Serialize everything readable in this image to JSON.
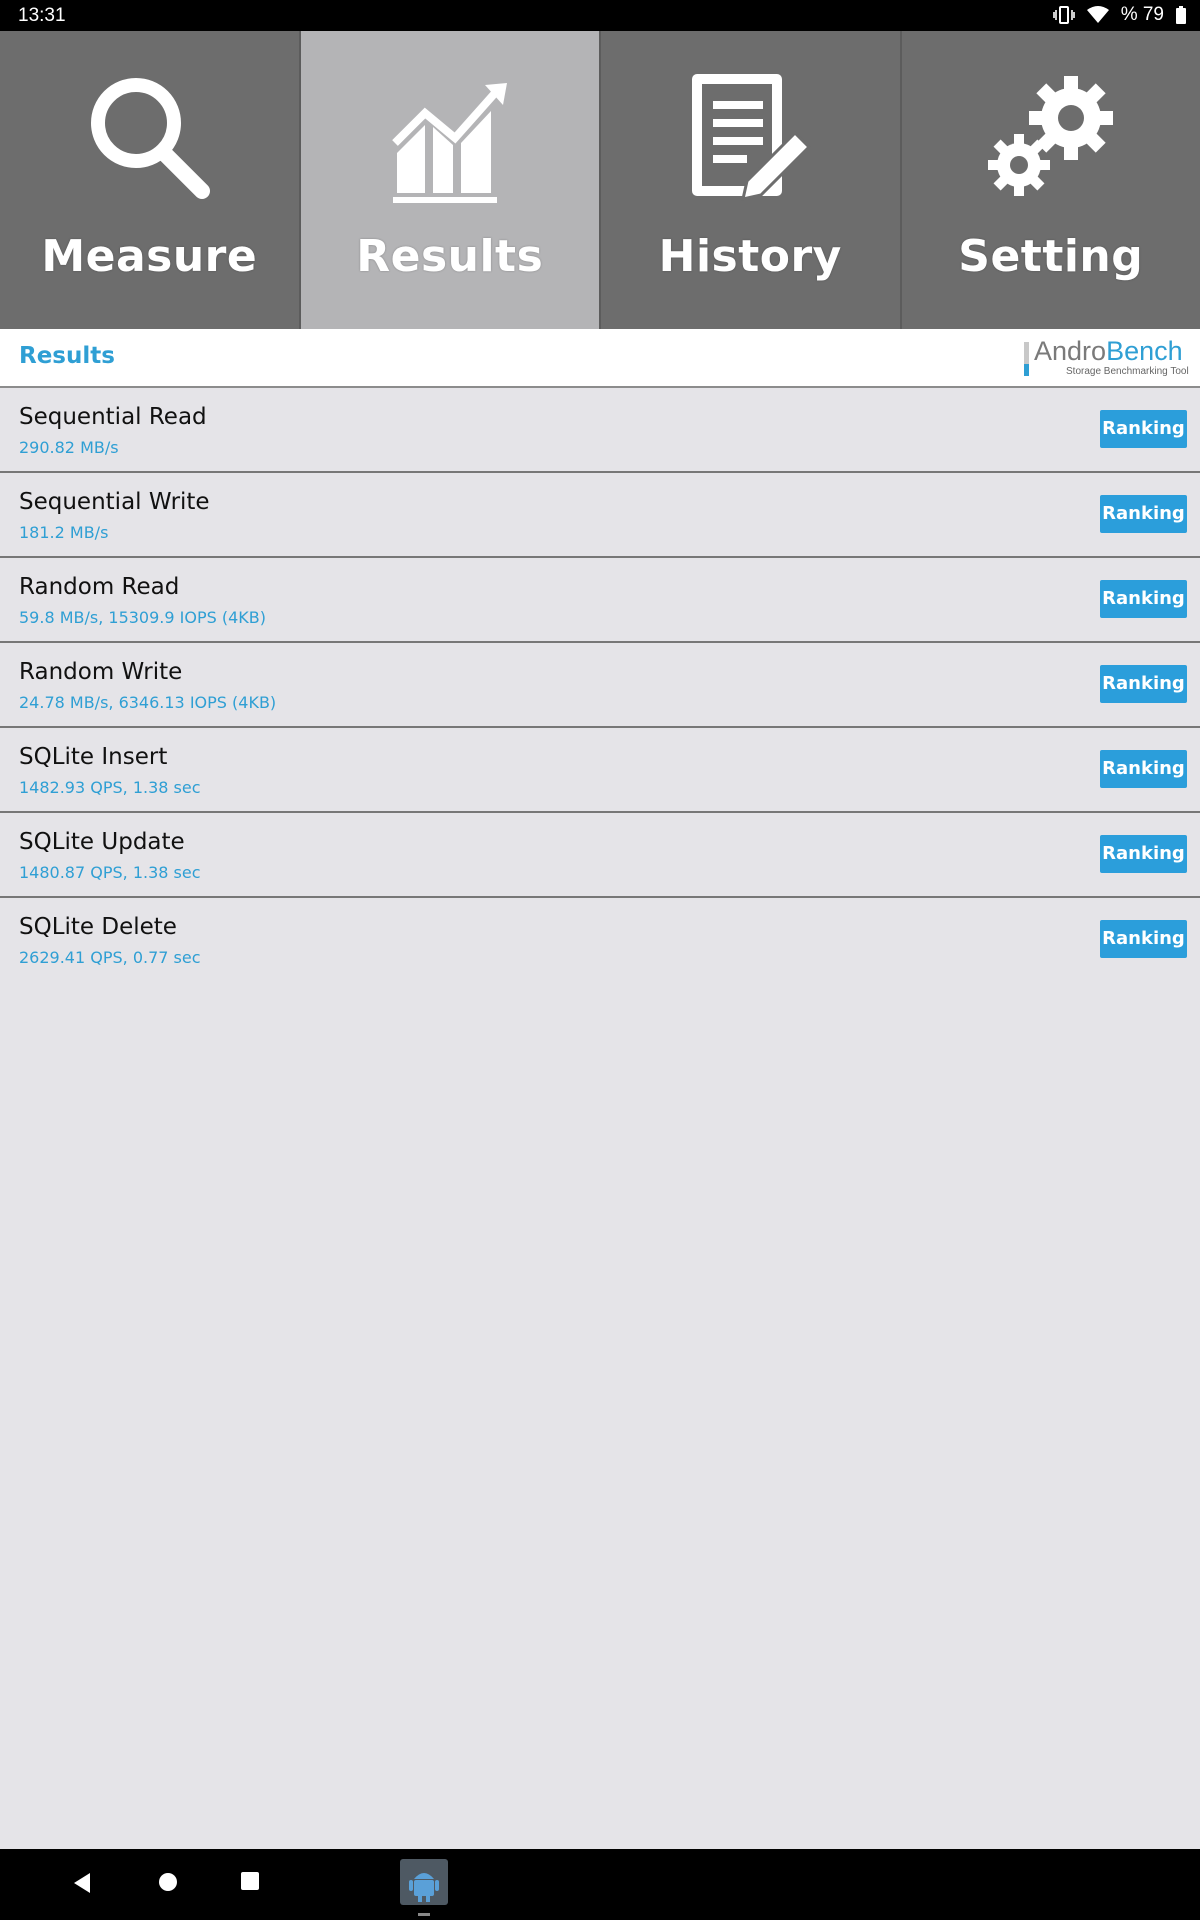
{
  "status_bar": {
    "time": "13:31",
    "battery_text": "% 79",
    "icons": [
      "vibrate-icon",
      "wifi-icon",
      "battery-icon"
    ]
  },
  "tabs": [
    {
      "label": "Measure",
      "icon": "magnifier-icon",
      "active": false
    },
    {
      "label": "Results",
      "icon": "chart-icon",
      "active": true
    },
    {
      "label": "History",
      "icon": "document-icon",
      "active": false
    },
    {
      "label": "Setting",
      "icon": "gears-icon",
      "active": false
    }
  ],
  "header": {
    "title": "Results",
    "logo_brand_part1": "Andro",
    "logo_brand_part2": "Bench",
    "logo_tagline": "Storage Benchmarking Tool"
  },
  "results": [
    {
      "name": "Sequential Read",
      "value": "290.82 MB/s",
      "button": "Ranking"
    },
    {
      "name": "Sequential Write",
      "value": "181.2 MB/s",
      "button": "Ranking"
    },
    {
      "name": "Random Read",
      "value": "59.8 MB/s, 15309.9 IOPS (4KB)",
      "button": "Ranking"
    },
    {
      "name": "Random Write",
      "value": "24.78 MB/s, 6346.13 IOPS (4KB)",
      "button": "Ranking"
    },
    {
      "name": "SQLite Insert",
      "value": "1482.93 QPS, 1.38 sec",
      "button": "Ranking"
    },
    {
      "name": "SQLite Update",
      "value": "1480.87 QPS, 1.38 sec",
      "button": "Ranking"
    },
    {
      "name": "SQLite Delete",
      "value": "2629.41 QPS, 0.77 sec",
      "button": "Ranking"
    }
  ],
  "colors": {
    "accent": "#2f9fd4",
    "button": "#2b9edb",
    "tab_bg": "#6d6d6d",
    "tab_active_bg": "#b4b4b6",
    "list_bg": "#e5e4e8"
  }
}
